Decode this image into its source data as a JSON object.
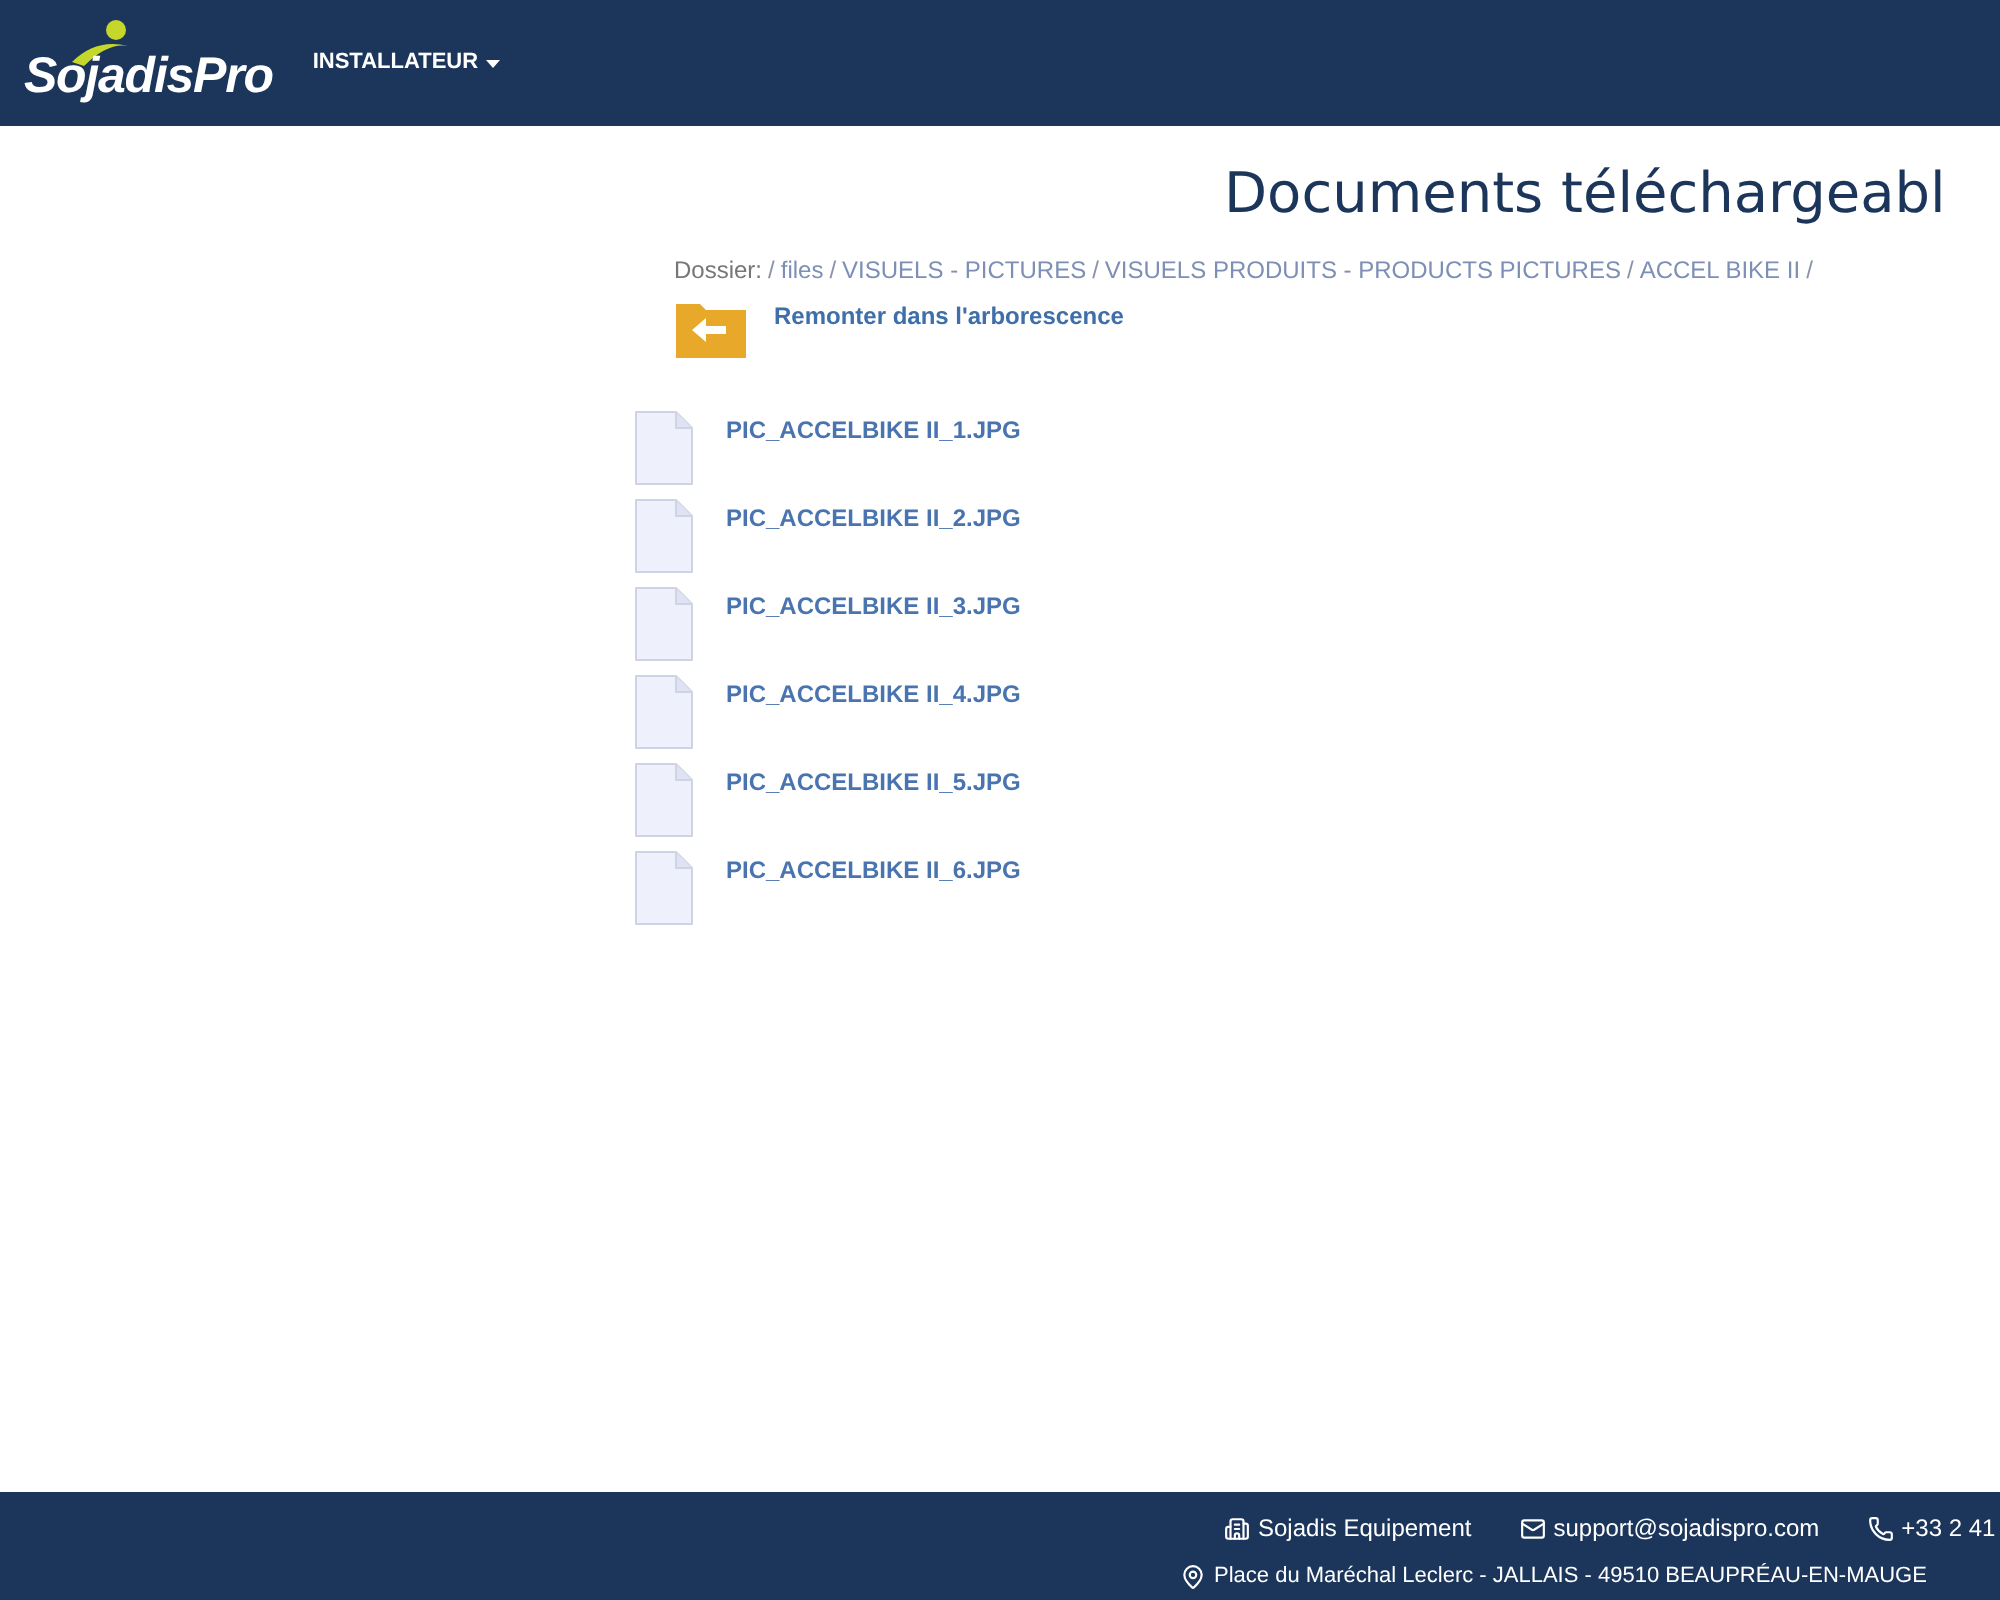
{
  "header": {
    "logo": "SojadisPro",
    "menu": {
      "label": "INSTALLATEUR"
    }
  },
  "page": {
    "title": "Documents téléchargeabl",
    "folder_label": "Dossier:",
    "separator": "/",
    "path": [
      "files",
      "VISUELS - PICTURES",
      "VISUELS PRODUITS - PRODUCTS PICTURES",
      "ACCEL BIKE II"
    ],
    "up_link": "Remonter dans l'arborescence",
    "files": [
      "PIC_ACCELBIKE II_1.JPG",
      "PIC_ACCELBIKE II_2.JPG",
      "PIC_ACCELBIKE II_3.JPG",
      "PIC_ACCELBIKE II_4.JPG",
      "PIC_ACCELBIKE II_5.JPG",
      "PIC_ACCELBIKE II_6.JPG"
    ]
  },
  "footer": {
    "company": "Sojadis Equipement",
    "email": "support@sojadispro.com",
    "phone": "+33 2 41",
    "address": "Place du Maréchal Leclerc - JALLAIS - 49510 BEAUPRÉAU-EN-MAUGE"
  }
}
